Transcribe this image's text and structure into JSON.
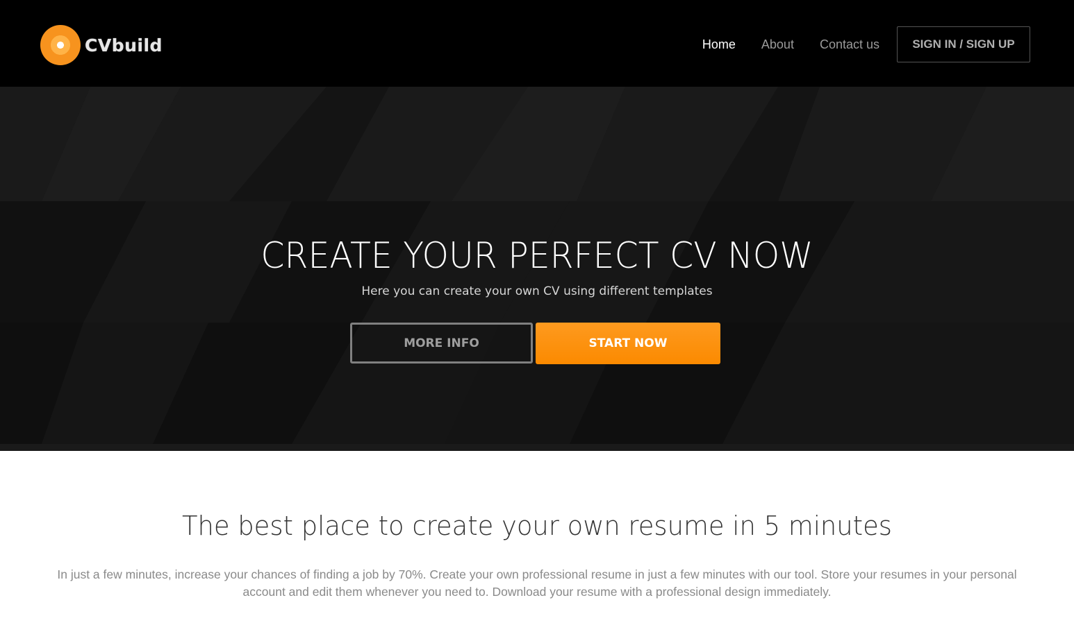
{
  "brand": {
    "name": "CVbuild",
    "logo_icon": "target-icon",
    "accent": "#f7931e"
  },
  "nav": {
    "items": [
      {
        "label": "Home",
        "active": true
      },
      {
        "label": "About",
        "active": false
      },
      {
        "label": "Contact us",
        "active": false
      }
    ],
    "auth_label": "SIGN IN / SIGN UP"
  },
  "hero": {
    "title": "CREATE YOUR PERFECT CV NOW",
    "subtitle": "Here you can create your own CV using different templates",
    "more_label": "MORE INFO",
    "start_label": "START NOW",
    "start_color": "#fb8c00"
  },
  "info": {
    "title": "The best place to create your own resume in 5 minutes",
    "text": "In just a few minutes, increase your chances of finding a job by 70%. Create your own professional resume in just a few minutes with our tool. Store your resumes in your personal account and edit them whenever you need to. Download your resume with a professional design immediately."
  }
}
